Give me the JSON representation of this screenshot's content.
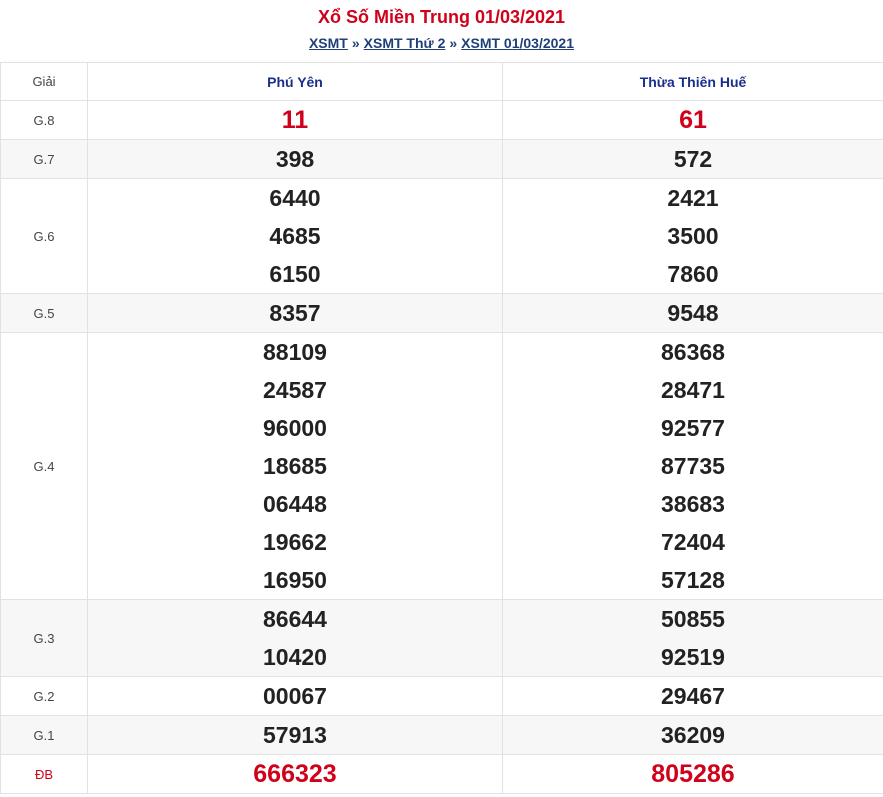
{
  "header": {
    "title": "Xổ Số Miền Trung 01/03/2021",
    "breadcrumb": [
      "XSMT",
      "XSMT Thứ 2",
      "XSMT 01/03/2021"
    ],
    "separator": "»"
  },
  "table": {
    "col_prize": "Giải",
    "provinces": [
      "Phú Yên",
      "Thừa Thiên Huế"
    ],
    "rows": [
      {
        "label": "G.8",
        "phu_yen": [
          "11"
        ],
        "hue": [
          "61"
        ]
      },
      {
        "label": "G.7",
        "phu_yen": [
          "398"
        ],
        "hue": [
          "572"
        ]
      },
      {
        "label": "G.6",
        "phu_yen": [
          "6440",
          "4685",
          "6150"
        ],
        "hue": [
          "2421",
          "3500",
          "7860"
        ]
      },
      {
        "label": "G.5",
        "phu_yen": [
          "8357"
        ],
        "hue": [
          "9548"
        ]
      },
      {
        "label": "G.4",
        "phu_yen": [
          "88109",
          "24587",
          "96000",
          "18685",
          "06448",
          "19662",
          "16950"
        ],
        "hue": [
          "86368",
          "28471",
          "92577",
          "87735",
          "38683",
          "72404",
          "57128"
        ]
      },
      {
        "label": "G.3",
        "phu_yen": [
          "86644",
          "10420"
        ],
        "hue": [
          "50855",
          "92519"
        ]
      },
      {
        "label": "G.2",
        "phu_yen": [
          "00067"
        ],
        "hue": [
          "29467"
        ]
      },
      {
        "label": "G.1",
        "phu_yen": [
          "57913"
        ],
        "hue": [
          "36209"
        ]
      },
      {
        "label": "ĐB",
        "phu_yen": [
          "666323"
        ],
        "hue": [
          "805286"
        ]
      }
    ]
  },
  "colors": {
    "accent_red": "#d0021b",
    "link_blue": "#1f3f7a",
    "header_blue": "#1a2f8a"
  }
}
